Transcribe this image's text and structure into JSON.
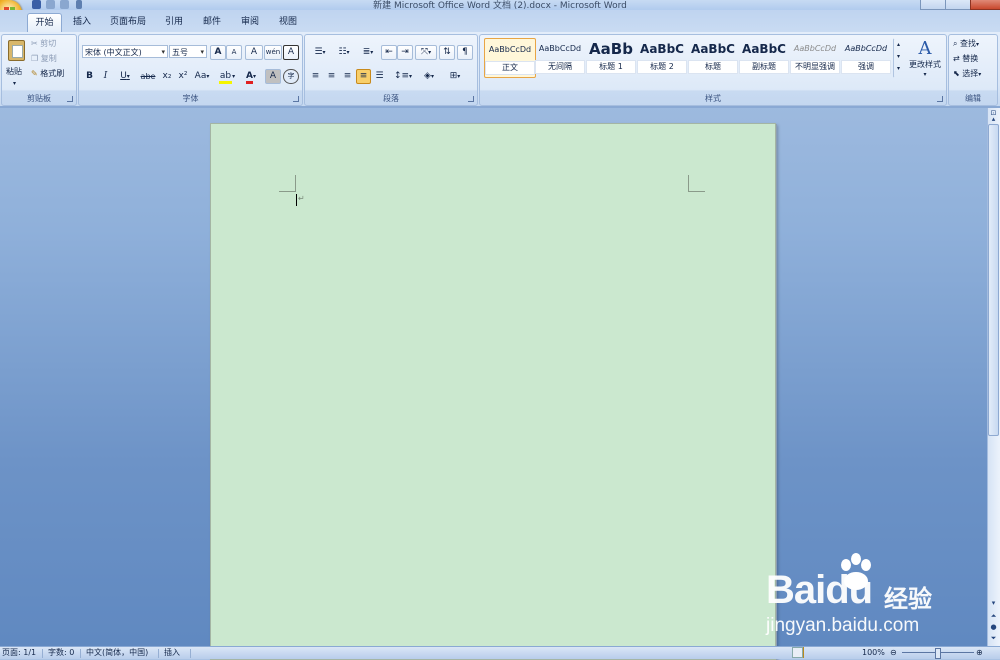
{
  "window": {
    "title": "新建 Microsoft Office Word 文档 (2).docx - Microsoft Word"
  },
  "tabs": [
    {
      "label": "开始",
      "active": true
    },
    {
      "label": "插入"
    },
    {
      "label": "页面布局"
    },
    {
      "label": "引用"
    },
    {
      "label": "邮件"
    },
    {
      "label": "审阅"
    },
    {
      "label": "视图"
    }
  ],
  "ribbon": {
    "clipboard": {
      "label": "剪贴板",
      "paste": "粘贴",
      "cut": "剪切",
      "copy": "复制",
      "format_painter": "格式刷"
    },
    "font": {
      "label": "字体",
      "font_name": "宋体 (中文正文)",
      "font_size": "五号",
      "bold": "B",
      "italic": "I",
      "underline": "U",
      "strike": "abe",
      "subscript": "x₂",
      "superscript": "x²",
      "change_case": "Aa",
      "grow": "A",
      "shrink": "A",
      "clear": "A",
      "highlight": "ab",
      "font_color": "A",
      "shading": "A",
      "enclose": "字",
      "phonetic": "wén",
      "border": "A",
      "font_color_value": "#e02020",
      "highlight_color_value": "#f5f500"
    },
    "paragraph": {
      "label": "段落"
    },
    "styles": {
      "label": "样式",
      "items": [
        {
          "sample": "AaBbCcDd",
          "name": "正文",
          "selected": true
        },
        {
          "sample": "AaBbCcDd",
          "name": "无间隔"
        },
        {
          "sample": "AaBb",
          "name": "标题 1"
        },
        {
          "sample": "AaBbC",
          "name": "标题 2"
        },
        {
          "sample": "AaBbC",
          "name": "标题"
        },
        {
          "sample": "AaBbC",
          "name": "副标题"
        },
        {
          "sample": "AaBbCcDd",
          "name": "不明显强调"
        },
        {
          "sample": "AaBbCcDd",
          "name": "强调"
        }
      ],
      "change_styles": "更改样式"
    },
    "editing": {
      "label": "编辑",
      "find": "查找",
      "replace": "替换",
      "select": "选择"
    }
  },
  "status": {
    "page": "页面: 1/1",
    "words": "字数: 0",
    "language": "中文(简体，中国)",
    "mode": "插入",
    "zoom": "100%"
  },
  "watermark": {
    "logo": "Baidu",
    "brand_cn": "经验",
    "url": "jingyan.baidu.com"
  },
  "colors": {
    "page": "#cbe8cf",
    "ribbon": "#dde9f8",
    "background": "#6d93c7"
  }
}
